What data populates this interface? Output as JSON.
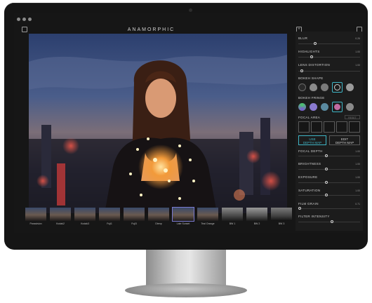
{
  "app": {
    "title": "ANAMORPHIC"
  },
  "toolbar": {
    "export_icon": "share-icon",
    "import_icon": "import-icon",
    "add_icon": "plus-icon"
  },
  "filmstrip": [
    {
      "label": "Panavision"
    },
    {
      "label": "Kodak2"
    },
    {
      "label": "Kodak3"
    },
    {
      "label": "Fuji1"
    },
    {
      "label": "Fuji3"
    },
    {
      "label": "Dtenp"
    },
    {
      "label": "Late Sunset",
      "selected": true
    },
    {
      "label": "Teal Orange"
    },
    {
      "label": "BW 1"
    },
    {
      "label": "BW 2"
    },
    {
      "label": "BW 3"
    }
  ],
  "panel": {
    "blur": {
      "label": "BLUR",
      "value": "0.26",
      "level": 0.26
    },
    "highlights": {
      "label": "HIGHLIGHTS",
      "value": "1.00",
      "level": 0.2
    },
    "lens_distortion": {
      "label": "LENS DISTORTION",
      "value": "1.00",
      "level": 0.03
    },
    "bokeh_shape": {
      "label": "BOKEH SHAPE"
    },
    "bokeh_fringe": {
      "label": "BOKEH FRINGE"
    },
    "focal_area": {
      "label": "FOCAL AREA",
      "reset": "RESET"
    },
    "use_depth_map": {
      "line1": "USE",
      "line2": "DEPTH MAP"
    },
    "edit_depth_map": {
      "line1": "EDIT",
      "line2": "DEPTH MAP"
    },
    "focal_depth": {
      "label": "FOCAL DEPTH",
      "value": "1.00",
      "level": 0.45
    },
    "brightness": {
      "label": "BRIGHTNESS",
      "value": "1.00",
      "level": 0.45
    },
    "exposure": {
      "label": "EXPOSURE",
      "value": "1.00",
      "level": 0.45
    },
    "saturation": {
      "label": "SATURATION",
      "value": "1.00",
      "level": 0.45
    },
    "film_grain": {
      "label": "FILM GRAIN",
      "value": "0.71",
      "level": 0.0
    },
    "filter_intensity": {
      "label": "FILTER INTENSITY",
      "value": "1.00",
      "level": 0.55
    }
  },
  "colors": {
    "accent": "#3fb6c6",
    "panel": "#1c1c1c",
    "bezel": "#151515"
  }
}
